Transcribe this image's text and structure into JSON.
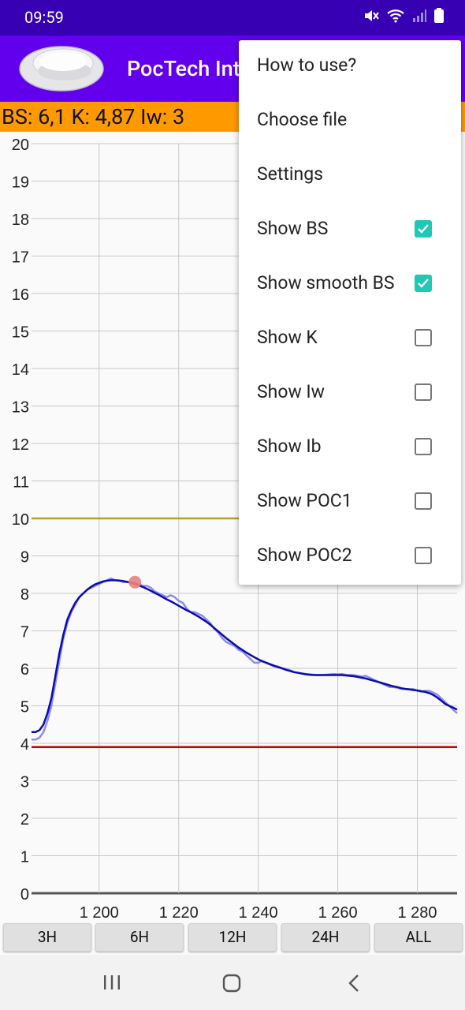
{
  "status_bar": {
    "time": "09:59"
  },
  "app_bar": {
    "title": "PocTech Interface"
  },
  "info_bar": {
    "text": "BS: 6,1 K: 4,87 Iw: 3"
  },
  "menu": {
    "items": [
      {
        "label": "How to use?"
      },
      {
        "label": "Choose file"
      },
      {
        "label": "Settings"
      },
      {
        "label": "Show BS",
        "checked": true
      },
      {
        "label": "Show smooth BS",
        "checked": true
      },
      {
        "label": "Show K",
        "checked": false
      },
      {
        "label": "Show Iw",
        "checked": false
      },
      {
        "label": "Show Ib",
        "checked": false
      },
      {
        "label": "Show POC1",
        "checked": false
      },
      {
        "label": "Show POC2",
        "checked": false
      }
    ]
  },
  "range_buttons": [
    "3H",
    "6H",
    "12H",
    "24H",
    "ALL"
  ],
  "colors": {
    "accent": "#1ec8b5",
    "app_bar": "#6200ee",
    "status_bar": "#3700b3",
    "info_bar": "#ff9900",
    "upper_limit": "#b8a020",
    "lower_limit": "#cc0000",
    "raw_bs": "#8c8cf0",
    "smooth_bs": "#0b0bb0",
    "marker": "#f08080"
  },
  "chart_data": {
    "type": "line",
    "title": "",
    "xlabel": "",
    "ylabel": "",
    "ylim": [
      0,
      20
    ],
    "xlim": [
      1183,
      1290
    ],
    "x_ticks": [
      1200,
      1220,
      1240,
      1260,
      1280
    ],
    "x_tick_labels": [
      "1 200",
      "1 220",
      "1 240",
      "1 260",
      "1 280"
    ],
    "y_ticks": [
      0,
      1,
      2,
      3,
      4,
      5,
      6,
      7,
      8,
      9,
      10,
      11,
      12,
      13,
      14,
      15,
      16,
      17,
      18,
      19,
      20
    ],
    "reference_lines": [
      {
        "y": 10,
        "color": "#b8a020"
      },
      {
        "y": 3.9,
        "color": "#cc0000"
      }
    ],
    "marker": {
      "x": 1209,
      "y": 8.3
    },
    "series": [
      {
        "color": "#8c8cf0",
        "x": [
          1183,
          1184,
          1185,
          1186,
          1187,
          1188,
          1189,
          1190,
          1191,
          1192,
          1193,
          1194,
          1195,
          1196,
          1197,
          1198,
          1199,
          1200,
          1201,
          1202,
          1203,
          1204,
          1205,
          1206,
          1207,
          1208,
          1209,
          1210,
          1211,
          1212,
          1213,
          1214,
          1215,
          1216,
          1217,
          1218,
          1219,
          1220,
          1221,
          1222,
          1223,
          1224,
          1225,
          1226,
          1227,
          1228,
          1229,
          1230,
          1231,
          1232,
          1233,
          1234,
          1235,
          1236,
          1237,
          1238,
          1239,
          1240,
          1241,
          1242,
          1243,
          1244,
          1245,
          1246,
          1247,
          1248,
          1249,
          1250,
          1251,
          1252,
          1253,
          1254,
          1255,
          1256,
          1257,
          1258,
          1259,
          1260,
          1261,
          1262,
          1263,
          1264,
          1265,
          1266,
          1267,
          1268,
          1269,
          1270,
          1271,
          1272,
          1273,
          1274,
          1275,
          1276,
          1277,
          1278,
          1279,
          1280,
          1281,
          1282,
          1283,
          1284,
          1285,
          1286,
          1287,
          1288,
          1289,
          1290
        ],
        "y": [
          4.1,
          4.1,
          4.15,
          4.3,
          4.6,
          5,
          5.6,
          6.2,
          6.8,
          7.2,
          7.5,
          7.7,
          7.9,
          8,
          8.1,
          8.15,
          8.2,
          8.25,
          8.3,
          8.35,
          8.4,
          8.35,
          8.35,
          8.3,
          8.3,
          8.3,
          8.3,
          8.25,
          8.2,
          8.2,
          8.15,
          8.05,
          8.0,
          7.95,
          7.9,
          7.95,
          7.9,
          7.8,
          7.75,
          7.6,
          7.5,
          7.5,
          7.45,
          7.4,
          7.3,
          7.2,
          7.05,
          6.95,
          6.8,
          6.7,
          6.65,
          6.6,
          6.5,
          6.45,
          6.35,
          6.25,
          6.15,
          6.15,
          6.2,
          6.15,
          6.1,
          6.05,
          6.05,
          6.0,
          5.98,
          5.95,
          5.9,
          5.88,
          5.86,
          5.85,
          5.84,
          5.83,
          5.82,
          5.82,
          5.83,
          5.84,
          5.85,
          5.84,
          5.85,
          5.83,
          5.82,
          5.82,
          5.8,
          5.78,
          5.8,
          5.75,
          5.7,
          5.65,
          5.6,
          5.55,
          5.5,
          5.5,
          5.48,
          5.45,
          5.45,
          5.44,
          5.45,
          5.4,
          5.38,
          5.4,
          5.4,
          5.35,
          5.3,
          5.2,
          5.1,
          5.0,
          4.9,
          4.8
        ]
      },
      {
        "color": "#0b0bb0",
        "x": [
          1183,
          1184,
          1185,
          1186,
          1187,
          1188,
          1189,
          1190,
          1191,
          1192,
          1193,
          1194,
          1195,
          1196,
          1197,
          1198,
          1199,
          1200,
          1201,
          1202,
          1203,
          1204,
          1205,
          1206,
          1207,
          1208,
          1209,
          1210,
          1211,
          1212,
          1213,
          1214,
          1215,
          1216,
          1217,
          1218,
          1219,
          1220,
          1221,
          1222,
          1223,
          1224,
          1225,
          1226,
          1227,
          1228,
          1229,
          1230,
          1231,
          1232,
          1233,
          1234,
          1235,
          1236,
          1237,
          1238,
          1239,
          1240,
          1241,
          1242,
          1243,
          1244,
          1245,
          1246,
          1247,
          1248,
          1249,
          1250,
          1251,
          1252,
          1253,
          1254,
          1255,
          1256,
          1257,
          1258,
          1259,
          1260,
          1261,
          1262,
          1263,
          1264,
          1265,
          1266,
          1267,
          1268,
          1269,
          1270,
          1271,
          1272,
          1273,
          1274,
          1275,
          1276,
          1277,
          1278,
          1279,
          1280,
          1281,
          1282,
          1283,
          1284,
          1285,
          1286,
          1287,
          1288,
          1289,
          1290
        ],
        "y": [
          4.3,
          4.3,
          4.35,
          4.5,
          4.8,
          5.2,
          5.8,
          6.4,
          6.9,
          7.3,
          7.55,
          7.75,
          7.9,
          8.0,
          8.1,
          8.18,
          8.24,
          8.28,
          8.32,
          8.34,
          8.35,
          8.35,
          8.34,
          8.33,
          8.31,
          8.28,
          8.25,
          8.21,
          8.17,
          8.12,
          8.07,
          8.01,
          7.96,
          7.9,
          7.84,
          7.79,
          7.73,
          7.67,
          7.61,
          7.55,
          7.5,
          7.44,
          7.38,
          7.31,
          7.24,
          7.16,
          7.07,
          6.98,
          6.89,
          6.8,
          6.72,
          6.64,
          6.56,
          6.49,
          6.42,
          6.36,
          6.3,
          6.24,
          6.19,
          6.15,
          6.11,
          6.07,
          6.03,
          6.0,
          5.96,
          5.93,
          5.9,
          5.88,
          5.86,
          5.84,
          5.83,
          5.82,
          5.82,
          5.82,
          5.82,
          5.82,
          5.82,
          5.82,
          5.82,
          5.81,
          5.8,
          5.79,
          5.77,
          5.75,
          5.73,
          5.7,
          5.67,
          5.64,
          5.61,
          5.58,
          5.55,
          5.52,
          5.5,
          5.47,
          5.45,
          5.44,
          5.42,
          5.41,
          5.39,
          5.37,
          5.34,
          5.29,
          5.22,
          5.14,
          5.05,
          5.0,
          4.95,
          4.9
        ]
      }
    ]
  }
}
